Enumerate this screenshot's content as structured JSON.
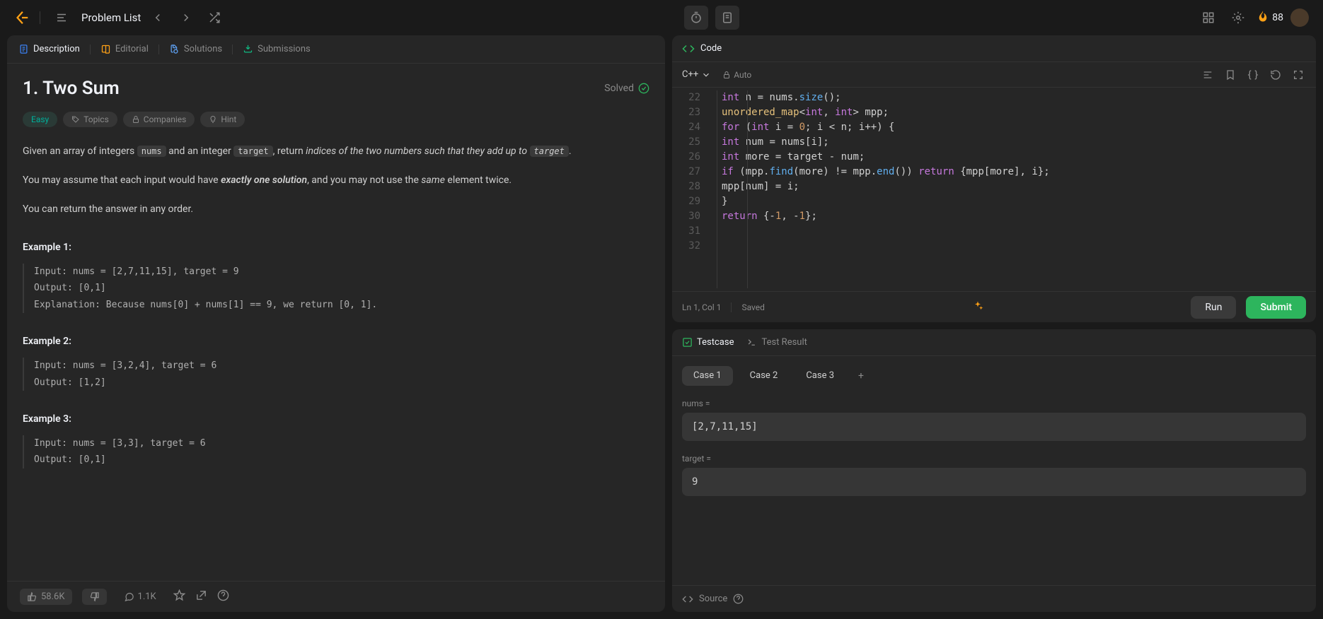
{
  "topbar": {
    "problem_list": "Problem List",
    "streak": "88"
  },
  "left_tabs": {
    "description": "Description",
    "editorial": "Editorial",
    "solutions": "Solutions",
    "submissions": "Submissions"
  },
  "problem": {
    "title": "1. Two Sum",
    "solved": "Solved",
    "difficulty": "Easy",
    "tags": {
      "topics": "Topics",
      "companies": "Companies",
      "hint": "Hint"
    },
    "desc_p1_a": "Given an array of integers ",
    "desc_p1_code1": "nums",
    "desc_p1_b": " and an integer ",
    "desc_p1_code2": "target",
    "desc_p1_c": ", return ",
    "desc_p1_em": "indices of the two numbers such that they add up to ",
    "desc_p1_code3": "target",
    "desc_p1_d": ".",
    "desc_p2_a": "You may assume that each input would have ",
    "desc_p2_strong": "exactly one solution",
    "desc_p2_b": ", and you may not use the ",
    "desc_p2_em": "same",
    "desc_p2_c": " element twice.",
    "desc_p3": "You can return the answer in any order.",
    "ex1_h": "Example 1:",
    "ex1_body": "Input: nums = [2,7,11,15], target = 9\nOutput: [0,1]\nExplanation: Because nums[0] + nums[1] == 9, we return [0, 1].",
    "ex2_h": "Example 2:",
    "ex2_body": "Input: nums = [3,2,4], target = 6\nOutput: [1,2]",
    "ex3_h": "Example 3:",
    "ex3_body": "Input: nums = [3,3], target = 6\nOutput: [0,1]"
  },
  "left_footer": {
    "likes": "58.6K",
    "dislikes": "",
    "comments": "1.1K"
  },
  "code": {
    "header": "Code",
    "language": "C++",
    "auto": "Auto",
    "cursor": "Ln 1, Col 1",
    "saved": "Saved",
    "run": "Run",
    "submit": "Submit",
    "lines": {
      "start": 22,
      "content": [
        "        int n = nums.size();",
        "        unordered_map<int, int> mpp;",
        "        for (int i = 0; i < n; i++)  {",
        "            int num = nums[i];",
        "            int more = target - num;",
        "            if (mpp.find(more) != mpp.end()) return {mpp[more], i};",
        "            mpp[num] = i;",
        "        }",
        "        return {-1, -1};",
        "",
        ""
      ]
    }
  },
  "testcase": {
    "tab_testcase": "Testcase",
    "tab_result": "Test Result",
    "cases": [
      "Case 1",
      "Case 2",
      "Case 3"
    ],
    "field_nums_label": "nums =",
    "field_nums_value": "[2,7,11,15]",
    "field_target_label": "target =",
    "field_target_value": "9",
    "source": "Source"
  }
}
